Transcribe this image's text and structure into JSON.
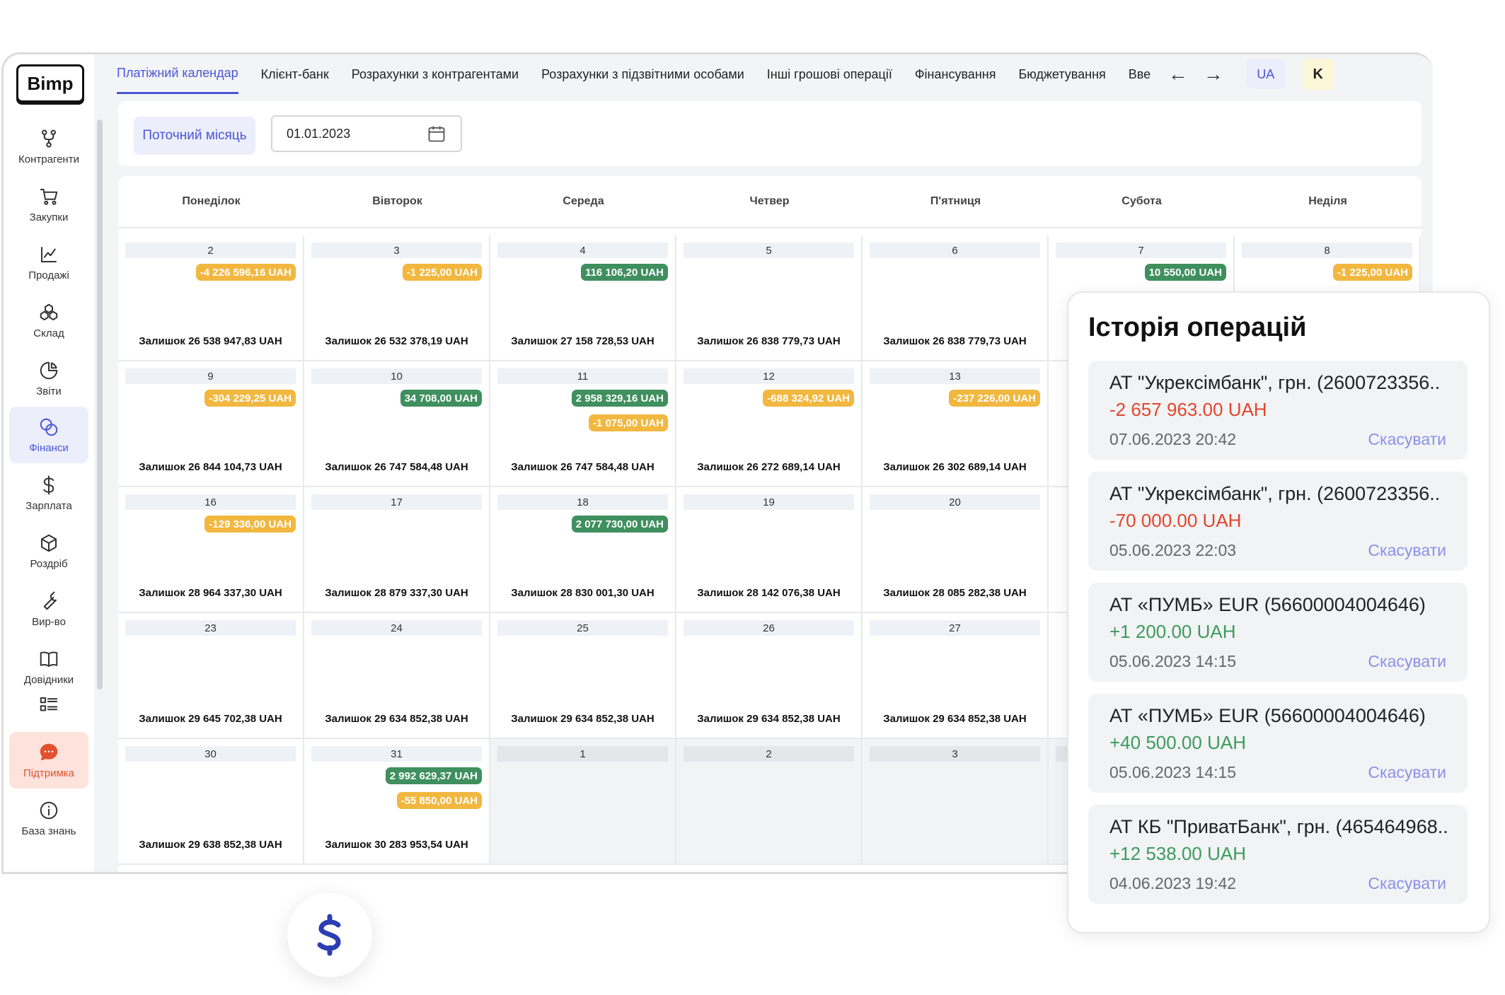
{
  "brand": {
    "logo": "Bimp"
  },
  "sidebar": {
    "items": [
      {
        "label": "Контрагенти",
        "icon": "fork-icon"
      },
      {
        "label": "Закупки",
        "icon": "cart-icon"
      },
      {
        "label": "Продажі",
        "icon": "chart-line-icon"
      },
      {
        "label": "Склад",
        "icon": "boxes-icon"
      },
      {
        "label": "Звіти",
        "icon": "pie-icon"
      },
      {
        "label": "Фінанси",
        "icon": "coins-icon",
        "active": true
      },
      {
        "label": "Зарплата",
        "icon": "dollar-icon"
      },
      {
        "label": "Роздріб",
        "icon": "cube-icon"
      },
      {
        "label": "Вир-во",
        "icon": "wrench-icon"
      },
      {
        "label": "Довідники",
        "icon": "book-icon"
      },
      {
        "label": "",
        "icon": "list-icon"
      },
      {
        "label": "Підтримка",
        "icon": "chat-icon"
      },
      {
        "label": "База знань",
        "icon": "info-icon"
      }
    ]
  },
  "tabs": [
    {
      "label": "Платіжний календар",
      "active": true
    },
    {
      "label": "Клієнт-банк"
    },
    {
      "label": "Розрахунки з контрагентами"
    },
    {
      "label": "Розрахунки з підзвітними особами"
    },
    {
      "label": "Інші грошові операції"
    },
    {
      "label": "Фінансування"
    },
    {
      "label": "Бюджетування"
    },
    {
      "label": "Вве"
    }
  ],
  "header": {
    "lang": "UA",
    "user_initial": "K"
  },
  "filter": {
    "current_month": "Поточний місяць",
    "date_value": "01.01.2023"
  },
  "calendar": {
    "weekdays": [
      "Понеділок",
      "Вівторок",
      "Середа",
      "Четвер",
      "П'ятниця",
      "Субота",
      "Неділя"
    ],
    "rows": [
      [
        {
          "day": "2",
          "badges": [
            {
              "text": "-4 226 596,16 UAH",
              "type": "neg"
            }
          ],
          "balance": "Залишок 26 538 947,83 UAH"
        },
        {
          "day": "3",
          "badges": [
            {
              "text": "-1 225,00 UAH",
              "type": "neg"
            }
          ],
          "balance": "Залишок 26 532 378,19 UAH"
        },
        {
          "day": "4",
          "badges": [
            {
              "text": "116 106,20 UAH",
              "type": "pos"
            }
          ],
          "balance": "Залишок 27 158 728,53 UAH"
        },
        {
          "day": "5",
          "badges": [],
          "balance": "Залишок 26 838 779,73 UAH"
        },
        {
          "day": "6",
          "badges": [],
          "balance": "Залишок 26 838 779,73 UAH"
        },
        {
          "day": "7",
          "badges": [
            {
              "text": "10 550,00 UAH",
              "type": "pos"
            }
          ],
          "balance": ""
        },
        {
          "day": "8",
          "badges": [
            {
              "text": "-1 225,00 UAH",
              "type": "neg"
            }
          ],
          "balance": ""
        }
      ],
      [
        {
          "day": "9",
          "badges": [
            {
              "text": "-304 229,25 UAH",
              "type": "neg"
            }
          ],
          "balance": "Залишок 26 844 104,73 UAH"
        },
        {
          "day": "10",
          "badges": [
            {
              "text": "34 708,00 UAH",
              "type": "pos"
            }
          ],
          "balance": "Залишок 26 747 584,48 UAH"
        },
        {
          "day": "11",
          "badges": [
            {
              "text": "2 958 329,16 UAH",
              "type": "pos"
            },
            {
              "text": "-1 075,00 UAH",
              "type": "neg"
            }
          ],
          "balance": "Залишок 26 747 584,48 UAH"
        },
        {
          "day": "12",
          "badges": [
            {
              "text": "-688 324,92 UAH",
              "type": "neg"
            }
          ],
          "balance": "Залишок 26 272 689,14 UAH"
        },
        {
          "day": "13",
          "badges": [
            {
              "text": "-237 226,00 UAH",
              "type": "neg"
            }
          ],
          "balance": "Залишок 26 302 689,14 UAH"
        },
        {
          "day": "",
          "badges": [],
          "balance": ""
        },
        {
          "day": "",
          "badges": [],
          "balance": ""
        }
      ],
      [
        {
          "day": "16",
          "badges": [
            {
              "text": "-129 336,00 UAH",
              "type": "neg"
            }
          ],
          "balance": "Залишок 28 964 337,30 UAH"
        },
        {
          "day": "17",
          "badges": [],
          "balance": "Залишок 28 879 337,30 UAH"
        },
        {
          "day": "18",
          "badges": [
            {
              "text": "2 077 730,00 UAH",
              "type": "pos"
            }
          ],
          "balance": "Залишок 28 830 001,30 UAH"
        },
        {
          "day": "19",
          "badges": [],
          "balance": "Залишок 28 142 076,38 UAH"
        },
        {
          "day": "20",
          "badges": [],
          "balance": "Залишок 28 085 282,38 UAH"
        },
        {
          "day": "",
          "badges": [],
          "balance": ""
        },
        {
          "day": "",
          "badges": [],
          "balance": ""
        }
      ],
      [
        {
          "day": "23",
          "badges": [],
          "balance": "Залишок 29 645 702,38 UAH"
        },
        {
          "day": "24",
          "badges": [],
          "balance": "Залишок 29 634 852,38 UAH"
        },
        {
          "day": "25",
          "badges": [],
          "balance": "Залишок 29 634 852,38 UAH"
        },
        {
          "day": "26",
          "badges": [],
          "balance": "Залишок 29 634 852,38 UAH"
        },
        {
          "day": "27",
          "badges": [],
          "balance": "Залишок 29 634 852,38 UAH"
        },
        {
          "day": "",
          "badges": [],
          "balance": ""
        },
        {
          "day": "",
          "badges": [],
          "balance": ""
        }
      ],
      [
        {
          "day": "30",
          "badges": [],
          "balance": "Залишок 29 638 852,38 UAH"
        },
        {
          "day": "31",
          "badges": [
            {
              "text": "2 992 629,37 UAH",
              "type": "pos"
            },
            {
              "text": "-55 850,00 UAH",
              "type": "neg"
            }
          ],
          "balance": "Залишок 30 283 953,54 UAH"
        },
        {
          "day": "1",
          "badges": [],
          "balance": "",
          "gray": true
        },
        {
          "day": "2",
          "badges": [],
          "balance": "",
          "gray": true
        },
        {
          "day": "3",
          "badges": [],
          "balance": "",
          "gray": true
        },
        {
          "day": "",
          "badges": [],
          "balance": "",
          "gray": true
        },
        {
          "day": "",
          "badges": [],
          "balance": "",
          "gray": true
        }
      ]
    ]
  },
  "history": {
    "title": "Історія операцій",
    "cancel_label": "Скасувати",
    "operations": [
      {
        "name": "АТ \"Укрексімбанк\", грн. (2600723356..",
        "amount": "-2 657 963.00 UAH",
        "type": "neg",
        "date": "07.06.2023  20:42"
      },
      {
        "name": "АТ \"Укрексімбанк\", грн. (2600723356..",
        "amount": "-70 000.00 UAH",
        "type": "neg",
        "date": "05.06.2023  22:03"
      },
      {
        "name": "АТ «ПУМБ» EUR (56600004004646)",
        "amount": "+1 200.00 UAH",
        "type": "pos",
        "date": "05.06.2023  14:15"
      },
      {
        "name": "АТ «ПУМБ» EUR (56600004004646)",
        "amount": "+40 500.00 UAH",
        "type": "pos",
        "date": "05.06.2023  14:15"
      },
      {
        "name": "АТ КБ \"ПриватБанк\", грн. (465464968..",
        "amount": "+12 538.00 UAH",
        "type": "pos",
        "date": "04.06.2023  19:42"
      }
    ]
  },
  "colors": {
    "accent": "#4b55d6",
    "positive": "#3f8f5f",
    "negative": "#f1b73f",
    "support": "#e0522f"
  }
}
